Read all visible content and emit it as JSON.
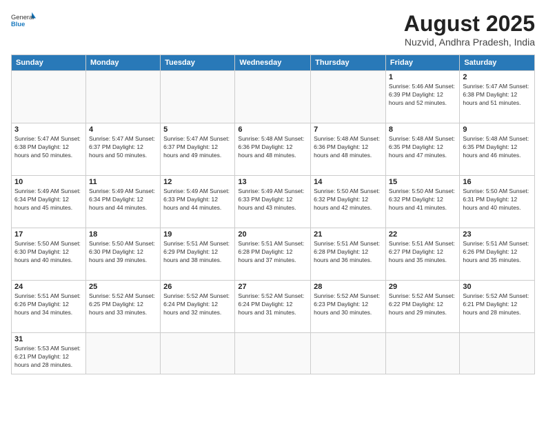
{
  "header": {
    "logo_general": "General",
    "logo_blue": "Blue",
    "month_title": "August 2025",
    "subtitle": "Nuzvid, Andhra Pradesh, India"
  },
  "weekdays": [
    "Sunday",
    "Monday",
    "Tuesday",
    "Wednesday",
    "Thursday",
    "Friday",
    "Saturday"
  ],
  "weeks": [
    [
      {
        "day": "",
        "info": ""
      },
      {
        "day": "",
        "info": ""
      },
      {
        "day": "",
        "info": ""
      },
      {
        "day": "",
        "info": ""
      },
      {
        "day": "",
        "info": ""
      },
      {
        "day": "1",
        "info": "Sunrise: 5:46 AM\nSunset: 6:39 PM\nDaylight: 12 hours\nand 52 minutes."
      },
      {
        "day": "2",
        "info": "Sunrise: 5:47 AM\nSunset: 6:38 PM\nDaylight: 12 hours\nand 51 minutes."
      }
    ],
    [
      {
        "day": "3",
        "info": "Sunrise: 5:47 AM\nSunset: 6:38 PM\nDaylight: 12 hours\nand 50 minutes."
      },
      {
        "day": "4",
        "info": "Sunrise: 5:47 AM\nSunset: 6:37 PM\nDaylight: 12 hours\nand 50 minutes."
      },
      {
        "day": "5",
        "info": "Sunrise: 5:47 AM\nSunset: 6:37 PM\nDaylight: 12 hours\nand 49 minutes."
      },
      {
        "day": "6",
        "info": "Sunrise: 5:48 AM\nSunset: 6:36 PM\nDaylight: 12 hours\nand 48 minutes."
      },
      {
        "day": "7",
        "info": "Sunrise: 5:48 AM\nSunset: 6:36 PM\nDaylight: 12 hours\nand 48 minutes."
      },
      {
        "day": "8",
        "info": "Sunrise: 5:48 AM\nSunset: 6:35 PM\nDaylight: 12 hours\nand 47 minutes."
      },
      {
        "day": "9",
        "info": "Sunrise: 5:48 AM\nSunset: 6:35 PM\nDaylight: 12 hours\nand 46 minutes."
      }
    ],
    [
      {
        "day": "10",
        "info": "Sunrise: 5:49 AM\nSunset: 6:34 PM\nDaylight: 12 hours\nand 45 minutes."
      },
      {
        "day": "11",
        "info": "Sunrise: 5:49 AM\nSunset: 6:34 PM\nDaylight: 12 hours\nand 44 minutes."
      },
      {
        "day": "12",
        "info": "Sunrise: 5:49 AM\nSunset: 6:33 PM\nDaylight: 12 hours\nand 44 minutes."
      },
      {
        "day": "13",
        "info": "Sunrise: 5:49 AM\nSunset: 6:33 PM\nDaylight: 12 hours\nand 43 minutes."
      },
      {
        "day": "14",
        "info": "Sunrise: 5:50 AM\nSunset: 6:32 PM\nDaylight: 12 hours\nand 42 minutes."
      },
      {
        "day": "15",
        "info": "Sunrise: 5:50 AM\nSunset: 6:32 PM\nDaylight: 12 hours\nand 41 minutes."
      },
      {
        "day": "16",
        "info": "Sunrise: 5:50 AM\nSunset: 6:31 PM\nDaylight: 12 hours\nand 40 minutes."
      }
    ],
    [
      {
        "day": "17",
        "info": "Sunrise: 5:50 AM\nSunset: 6:30 PM\nDaylight: 12 hours\nand 40 minutes."
      },
      {
        "day": "18",
        "info": "Sunrise: 5:50 AM\nSunset: 6:30 PM\nDaylight: 12 hours\nand 39 minutes."
      },
      {
        "day": "19",
        "info": "Sunrise: 5:51 AM\nSunset: 6:29 PM\nDaylight: 12 hours\nand 38 minutes."
      },
      {
        "day": "20",
        "info": "Sunrise: 5:51 AM\nSunset: 6:28 PM\nDaylight: 12 hours\nand 37 minutes."
      },
      {
        "day": "21",
        "info": "Sunrise: 5:51 AM\nSunset: 6:28 PM\nDaylight: 12 hours\nand 36 minutes."
      },
      {
        "day": "22",
        "info": "Sunrise: 5:51 AM\nSunset: 6:27 PM\nDaylight: 12 hours\nand 35 minutes."
      },
      {
        "day": "23",
        "info": "Sunrise: 5:51 AM\nSunset: 6:26 PM\nDaylight: 12 hours\nand 35 minutes."
      }
    ],
    [
      {
        "day": "24",
        "info": "Sunrise: 5:51 AM\nSunset: 6:26 PM\nDaylight: 12 hours\nand 34 minutes."
      },
      {
        "day": "25",
        "info": "Sunrise: 5:52 AM\nSunset: 6:25 PM\nDaylight: 12 hours\nand 33 minutes."
      },
      {
        "day": "26",
        "info": "Sunrise: 5:52 AM\nSunset: 6:24 PM\nDaylight: 12 hours\nand 32 minutes."
      },
      {
        "day": "27",
        "info": "Sunrise: 5:52 AM\nSunset: 6:24 PM\nDaylight: 12 hours\nand 31 minutes."
      },
      {
        "day": "28",
        "info": "Sunrise: 5:52 AM\nSunset: 6:23 PM\nDaylight: 12 hours\nand 30 minutes."
      },
      {
        "day": "29",
        "info": "Sunrise: 5:52 AM\nSunset: 6:22 PM\nDaylight: 12 hours\nand 29 minutes."
      },
      {
        "day": "30",
        "info": "Sunrise: 5:52 AM\nSunset: 6:21 PM\nDaylight: 12 hours\nand 28 minutes."
      }
    ],
    [
      {
        "day": "31",
        "info": "Sunrise: 5:53 AM\nSunset: 6:21 PM\nDaylight: 12 hours\nand 28 minutes."
      },
      {
        "day": "",
        "info": ""
      },
      {
        "day": "",
        "info": ""
      },
      {
        "day": "",
        "info": ""
      },
      {
        "day": "",
        "info": ""
      },
      {
        "day": "",
        "info": ""
      },
      {
        "day": "",
        "info": ""
      }
    ]
  ]
}
